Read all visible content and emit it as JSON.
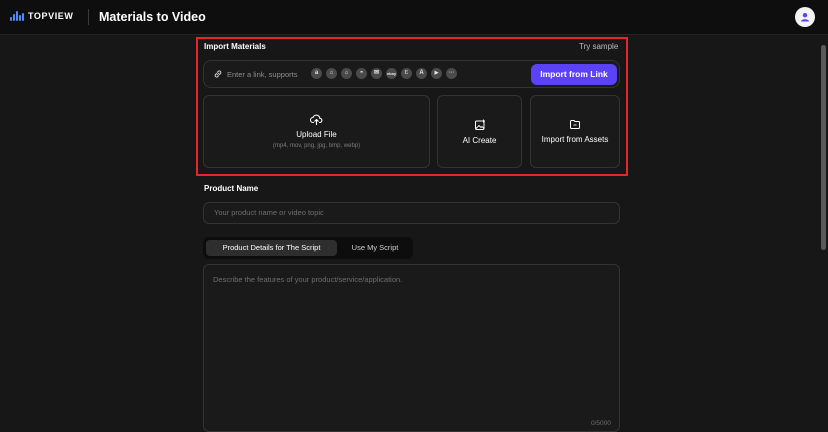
{
  "header": {
    "brand": "TOPVIEW",
    "title": "Materials to Video"
  },
  "import_materials": {
    "label": "Import Materials",
    "try_sample": "Try sample",
    "link_placeholder": "Enter a link, supports",
    "platforms": [
      "amazon",
      "shopify",
      "shopify-bag",
      "aliexpress",
      "mail",
      "ebay",
      "etsy",
      "app-store",
      "google-play",
      "more"
    ],
    "platform_glyphs": [
      "a",
      "⌂",
      "⌂",
      "◓",
      "✉",
      "ebay",
      "E",
      "A",
      "▶",
      "···"
    ],
    "import_button": "Import from Link",
    "accent_color": "#5b43f5",
    "highlight_color": "#e5252a",
    "cards": {
      "upload": {
        "title": "Upload File",
        "subtitle": "(mp4, mov, png, jpg, bmp, webp)"
      },
      "ai_create": {
        "title": "AI Create"
      },
      "assets": {
        "title": "Import from Assets"
      }
    }
  },
  "product_name": {
    "label": "Product Name",
    "placeholder": "Your product name or video topic"
  },
  "script_tabs": {
    "active": "Product Details for The Script",
    "inactive": "Use My Script"
  },
  "script": {
    "placeholder": "Describe the features of your product/service/application.",
    "counter": "0/5000"
  }
}
